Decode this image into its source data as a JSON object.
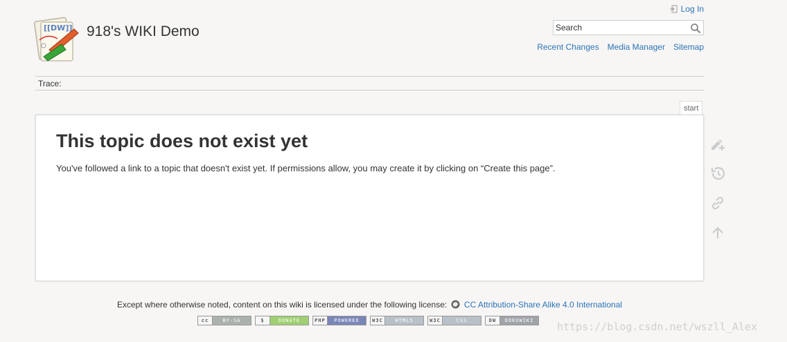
{
  "header": {
    "site_title": "918's WIKI Demo",
    "logo_text": "[[DW]]"
  },
  "user_tools": {
    "login_label": "Log In"
  },
  "search": {
    "value": "Search",
    "placeholder": ""
  },
  "site_tools": [
    {
      "label": "Recent Changes"
    },
    {
      "label": "Media Manager"
    },
    {
      "label": "Sitemap"
    }
  ],
  "breadcrumbs": {
    "label": "Trace:"
  },
  "page": {
    "id": "start",
    "heading": "This topic does not exist yet",
    "message": "You've followed a link to a topic that doesn't exist yet. If permissions allow, you may create it by clicking on “Create this page”."
  },
  "page_tools": [
    {
      "icon": "pencil-plus-icon"
    },
    {
      "icon": "history-icon"
    },
    {
      "icon": "link-icon"
    },
    {
      "icon": "arrow-up-icon"
    }
  ],
  "footer": {
    "license_text": "Except where otherwise noted, content on this wiki is licensed under the following license:",
    "license_link": "CC Attribution-Share Alike 4.0 International",
    "badges": [
      {
        "left": "cc",
        "right": "BY-SA",
        "color": "#aab2ab"
      },
      {
        "left": "$",
        "right": "DONATE",
        "color": "#9fcf72"
      },
      {
        "left": "PHP",
        "right": "POWERED",
        "color": "#7a86b8"
      },
      {
        "left": "W3C",
        "right": "HTML5",
        "color": "#b8c0c8"
      },
      {
        "left": "W3C",
        "right": "CSS",
        "color": "#b8c0c8"
      },
      {
        "left": "DW",
        "right": "DOKUWIKI",
        "color": "#a0a4a8"
      }
    ]
  },
  "watermark": "https://blog.csdn.net/wszll_Alex",
  "colors": {
    "link": "#2b73b7",
    "background": "#f7f6f5",
    "text": "#333333"
  }
}
